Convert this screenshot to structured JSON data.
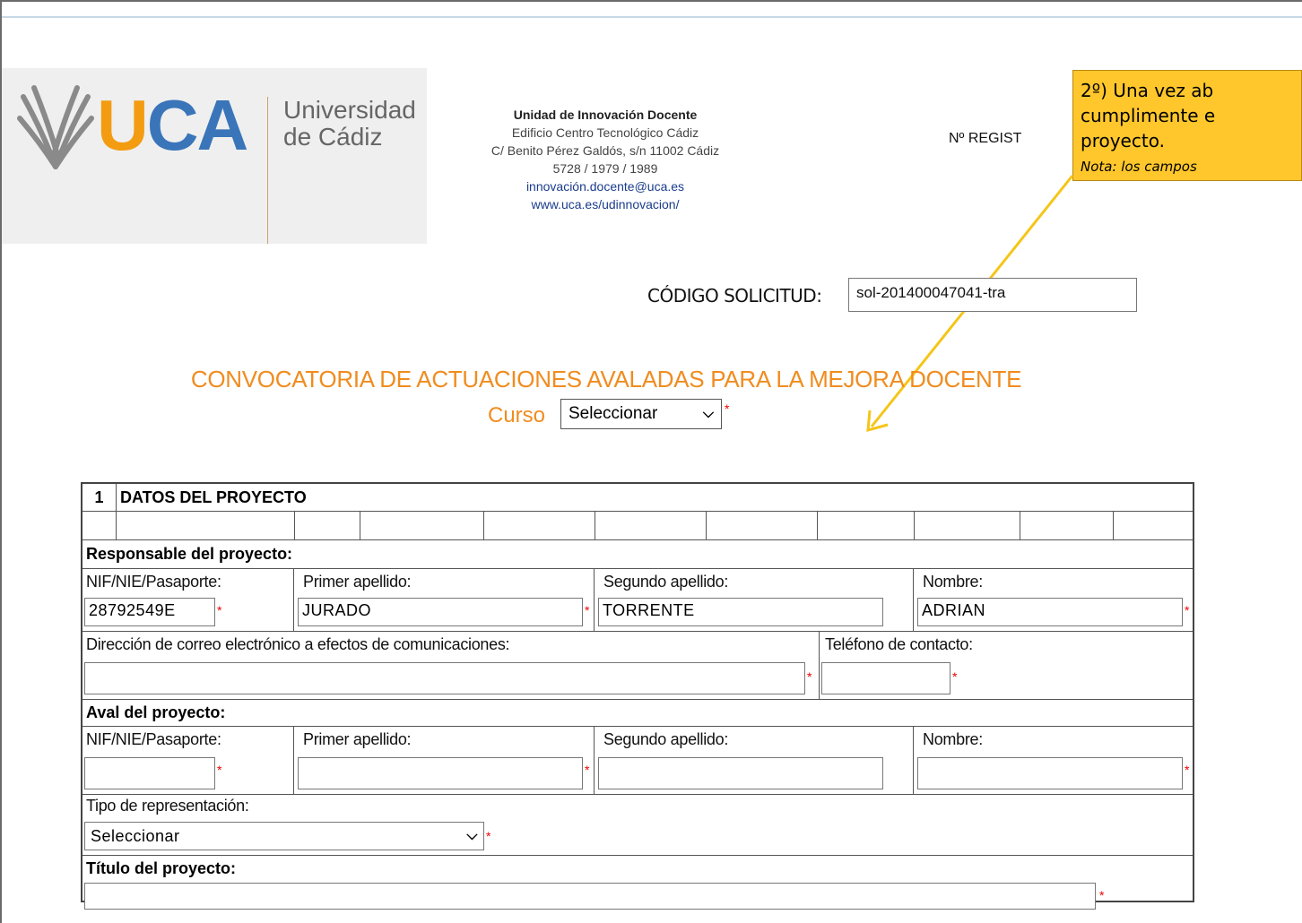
{
  "header": {
    "logo_text": "UCA",
    "university_line1": "Universidad",
    "university_line2": "de Cádiz",
    "unit_title": "Unidad de Innovación Docente",
    "unit_lines": [
      "Edificio Centro Tecnológico Cádiz",
      "C/ Benito Pérez Galdós, s/n 11002 Cádiz",
      "5728 / 1979 / 1989"
    ],
    "email": "innovación.docente@uca.es",
    "website": "www.uca.es/udinnovacion/",
    "registro_label": "Nº REGIST"
  },
  "callout": {
    "line1": "2º) Una vez ab",
    "line2": "cumplimente e",
    "line3": "proyecto.",
    "note": "Nota: los campos"
  },
  "codigo": {
    "label": "CÓDIGO SOLICITUD:",
    "value": "sol-201400047041-tra"
  },
  "convocatoria": {
    "title": "CONVOCATORIA DE ACTUACIONES AVALADAS PARA LA MEJORA DOCENTE",
    "curso_label": "Curso",
    "curso_value": "Seleccionar"
  },
  "form": {
    "section_number": "1",
    "section_title": "DATOS DEL PROYECTO",
    "responsable_title": "Responsable del proyecto:",
    "aval_title": "Aval del proyecto:",
    "nif_label": "NIF/NIE/Pasaporte:",
    "primer_label": "Primer apellido:",
    "segundo_label": "Segundo apellido:",
    "nombre_label": "Nombre:",
    "responsable": {
      "nif": "28792549E",
      "primer": "JURADO",
      "segundo": "TORRENTE",
      "nombre": "ADRIAN"
    },
    "email_label": "Dirección de correo electrónico a efectos de comunicaciones:",
    "telefono_label": "Teléfono de contacto:",
    "tipo_label": "Tipo de representación:",
    "tipo_value": "Seleccionar",
    "titulo_label": "Título del proyecto:",
    "required_mark": "*"
  },
  "colors": {
    "accent_orange": "#f08c1f",
    "callout_bg": "#ffc72c",
    "required": "#e00000"
  }
}
